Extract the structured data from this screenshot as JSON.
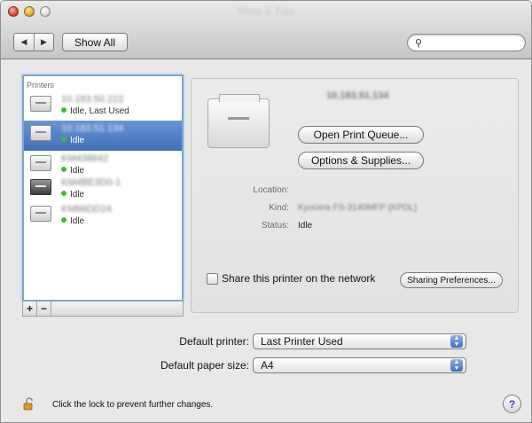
{
  "window": {
    "title": "Print & Fax"
  },
  "toolbar": {
    "back_glyph": "◀",
    "forward_glyph": "▶",
    "show_all_label": "Show All",
    "search_icon": "search-icon",
    "search_glyph": "⚲",
    "search_value": "",
    "search_placeholder": ""
  },
  "printers": {
    "heading": "Printers",
    "items": [
      {
        "name": "10.183.50.222",
        "status": "Idle, Last Used",
        "icon": "laser-printer-icon",
        "selected": false
      },
      {
        "name": "10.183.51.134",
        "status": "Idle",
        "icon": "laser-printer-icon",
        "selected": true
      },
      {
        "name": "KM438642",
        "status": "Idle",
        "icon": "laser-printer-icon",
        "selected": false
      },
      {
        "name": "KM4BE3D0-1",
        "status": "Idle",
        "icon": "inkjet-printer-icon",
        "selected": false
      },
      {
        "name": "KM66DD24",
        "status": "Idle",
        "icon": "laser-printer-icon",
        "selected": false
      }
    ],
    "add_label": "+",
    "remove_label": "−"
  },
  "details": {
    "name": "10.183.51.134",
    "open_queue_label": "Open Print Queue...",
    "options_label": "Options & Supplies...",
    "location_label": "Location:",
    "location_value": "",
    "kind_label": "Kind:",
    "kind_value": "Kyocera FS-3140MFP (KPDL)",
    "status_label": "Status:",
    "status_value": "Idle",
    "share_label": "Share this printer on the network",
    "share_checked": false,
    "sharing_prefs_label": "Sharing Preferences..."
  },
  "defaults": {
    "printer_label": "Default printer:",
    "printer_value": "Last Printer Used",
    "paper_label": "Default paper size:",
    "paper_value": "A4"
  },
  "footer": {
    "lock_text": "Click the lock to prevent further changes.",
    "help_label": "?"
  },
  "colors": {
    "selection": "#3f6fb9",
    "status_dot": "#44b83a"
  }
}
